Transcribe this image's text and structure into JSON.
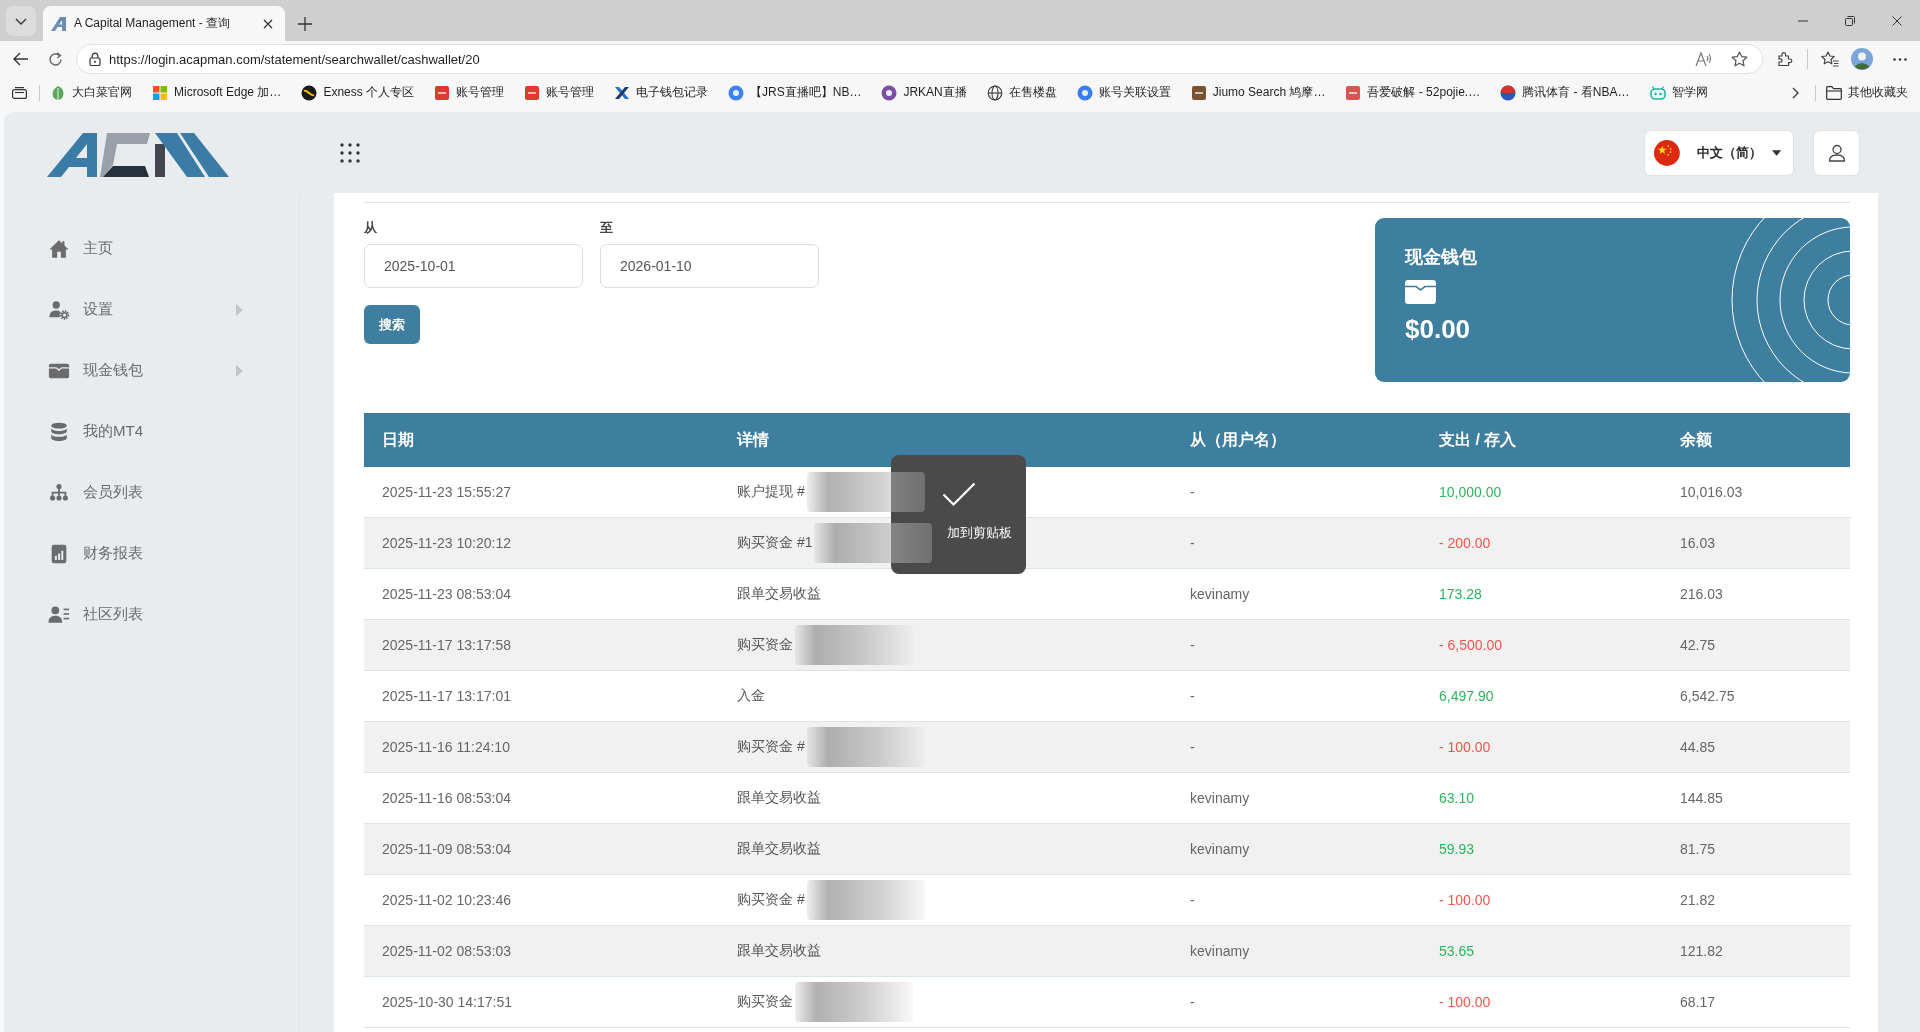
{
  "browser": {
    "tab_title": "A Capital Management - 查询",
    "url": "https://login.acapman.com/statement/searchwallet/cashwallet/20",
    "bookmarks": [
      "大白菜官网",
      "Microsoft Edge 加…",
      "Exness 个人专区",
      "账号管理",
      "账号管理",
      "电子钱包记录",
      "【JRS直播吧】NB…",
      "JRKAN直播",
      "在售楼盘",
      "账号关联设置",
      "Jiumo Search 鸠摩…",
      "吾爱破解 - 52pojie.…",
      "腾讯体育 - 看NBA…",
      "智学网"
    ],
    "other_bookmarks": "其他收藏夹"
  },
  "sidebar": {
    "items": [
      {
        "label": "主页",
        "submenu": false
      },
      {
        "label": "设置",
        "submenu": true
      },
      {
        "label": "现金钱包",
        "submenu": true
      },
      {
        "label": "我的MT4",
        "submenu": false
      },
      {
        "label": "会员列表",
        "submenu": false
      },
      {
        "label": "财务报表",
        "submenu": false
      },
      {
        "label": "社区列表",
        "submenu": false
      }
    ]
  },
  "header": {
    "language": "中文（简）"
  },
  "filters": {
    "from_label": "从",
    "from_value": "2025-10-01",
    "to_label": "至",
    "to_value": "2026-01-10",
    "search_button": "搜索"
  },
  "wallet_card": {
    "title": "现金钱包",
    "balance": "$0.00"
  },
  "table": {
    "columns": [
      "日期",
      "详情",
      "从（用户名）",
      "支出 / 存入",
      "余额"
    ],
    "rows": [
      {
        "date": "2025-11-23 15:55:27",
        "detail": "账户提现 #",
        "redacted": true,
        "from_user": "-",
        "amount": "10,000.00",
        "kind": "deposit",
        "balance": "10,016.03"
      },
      {
        "date": "2025-11-23 10:20:12",
        "detail": "购买资金 #1",
        "redacted": true,
        "from_user": "-",
        "amount": "- 200.00",
        "kind": "withdrawal",
        "balance": "16.03"
      },
      {
        "date": "2025-11-23 08:53:04",
        "detail": "跟单交易收益",
        "redacted": false,
        "from_user": "kevinamy",
        "amount": "173.28",
        "kind": "deposit",
        "balance": "216.03"
      },
      {
        "date": "2025-11-17 13:17:58",
        "detail": "购买资金",
        "redacted": true,
        "from_user": "-",
        "amount": "- 6,500.00",
        "kind": "withdrawal",
        "balance": "42.75"
      },
      {
        "date": "2025-11-17 13:17:01",
        "detail": "入金",
        "redacted": false,
        "from_user": "-",
        "amount": "6,497.90",
        "kind": "deposit",
        "balance": "6,542.75"
      },
      {
        "date": "2025-11-16 11:24:10",
        "detail": "购买资金 #",
        "redacted": true,
        "from_user": "-",
        "amount": "- 100.00",
        "kind": "withdrawal",
        "balance": "44.85"
      },
      {
        "date": "2025-11-16 08:53:04",
        "detail": "跟单交易收益",
        "redacted": false,
        "from_user": "kevinamy",
        "amount": "63.10",
        "kind": "deposit",
        "balance": "144.85"
      },
      {
        "date": "2025-11-09 08:53:04",
        "detail": "跟单交易收益",
        "redacted": false,
        "from_user": "kevinamy",
        "amount": "59.93",
        "kind": "deposit",
        "balance": "81.75"
      },
      {
        "date": "2025-11-02 10:23:46",
        "detail": "购买资金 #",
        "redacted": true,
        "from_user": "-",
        "amount": "- 100.00",
        "kind": "withdrawal",
        "balance": "21.82"
      },
      {
        "date": "2025-11-02 08:53:03",
        "detail": "跟单交易收益",
        "redacted": false,
        "from_user": "kevinamy",
        "amount": "53.65",
        "kind": "deposit",
        "balance": "121.82"
      },
      {
        "date": "2025-10-30 14:17:51",
        "detail": "购买资金",
        "redacted": true,
        "from_user": "-",
        "amount": "- 100.00",
        "kind": "withdrawal",
        "balance": "68.17"
      }
    ]
  },
  "toast": {
    "message": "加到剪贴板"
  }
}
